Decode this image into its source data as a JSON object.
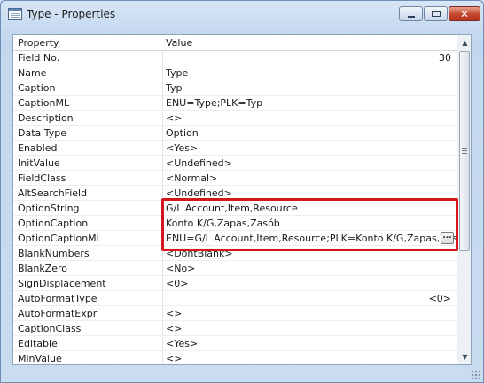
{
  "window": {
    "title": "Type - Properties"
  },
  "grid": {
    "header": {
      "property": "Property",
      "value": "Value"
    },
    "rows": [
      {
        "name": "Field No.",
        "value": "30",
        "align": "right"
      },
      {
        "name": "Name",
        "value": "Type"
      },
      {
        "name": "Caption",
        "value": "Typ"
      },
      {
        "name": "CaptionML",
        "value": "ENU=Type;PLK=Typ"
      },
      {
        "name": "Description",
        "value": "<>"
      },
      {
        "name": "Data Type",
        "value": "Option"
      },
      {
        "name": "Enabled",
        "value": "<Yes>"
      },
      {
        "name": "InitValue",
        "value": "<Undefined>"
      },
      {
        "name": "FieldClass",
        "value": "<Normal>"
      },
      {
        "name": "AltSearchField",
        "value": "<Undefined>"
      },
      {
        "name": "OptionString",
        "value": "G/L Account,Item,Resource"
      },
      {
        "name": "OptionCaption",
        "value": "Konto K/G,Zapas,Zasób"
      },
      {
        "name": "OptionCaptionML",
        "value": "ENU=G/L Account,Item,Resource;PLK=Konto K/G,Zapas,Zasób",
        "has_button": true,
        "button_label": "..."
      },
      {
        "name": "BlankNumbers",
        "value": "<DontBlank>"
      },
      {
        "name": "BlankZero",
        "value": "<No>"
      },
      {
        "name": "SignDisplacement",
        "value": "<0>"
      },
      {
        "name": "AutoFormatType",
        "value": "<0>",
        "align": "right"
      },
      {
        "name": "AutoFormatExpr",
        "value": "<>"
      },
      {
        "name": "CaptionClass",
        "value": "<>"
      },
      {
        "name": "Editable",
        "value": "<Yes>"
      },
      {
        "name": "MinValue",
        "value": "<>"
      }
    ]
  },
  "colors": {
    "highlight": "#d3171d",
    "close_button": "#c5452d"
  },
  "icons": {
    "app": "table-properties-icon",
    "minimize": "minimize-icon",
    "maximize": "maximize-icon",
    "close": "close-icon"
  }
}
